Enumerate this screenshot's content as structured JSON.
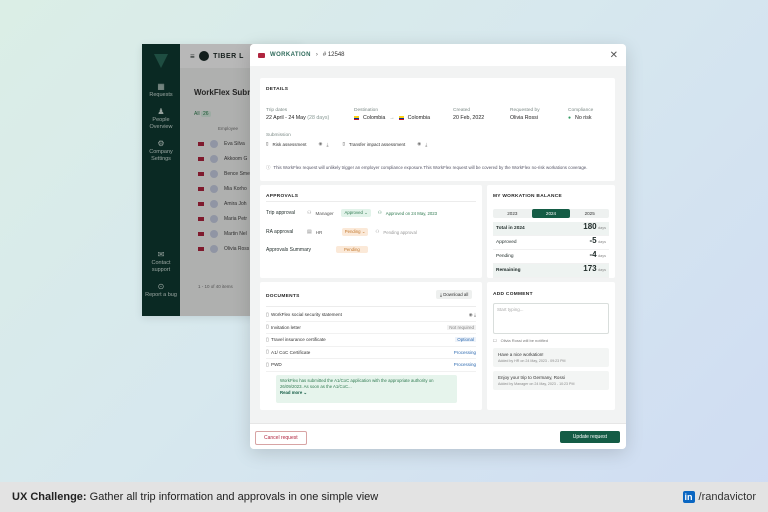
{
  "caption": {
    "challenge_label": "UX Challenge:",
    "challenge_text": "Gather all trip information and approvals in one simple view",
    "linkedin": "in",
    "handle": "/randavictor"
  },
  "app": {
    "brand": "TIBER L",
    "heading": "WorkFlex Submis",
    "filter": "All",
    "filter_count": "26",
    "employee_label": "Employee",
    "sidebar": [
      {
        "icon": "grid-icon",
        "label": "Requests"
      },
      {
        "icon": "user-icon",
        "label": "People Overview"
      },
      {
        "icon": "gear-icon",
        "label": "Company Settings"
      },
      {
        "icon": "mail-icon",
        "label": "Contact support"
      },
      {
        "icon": "bug-icon",
        "label": "Report a bug"
      }
    ],
    "rows": [
      "Eva Silva",
      "Akkoom G",
      "Bence Sme",
      "Mia Korho",
      "Amira Joh",
      "Maria Petr",
      "Martin Nel",
      "Olivia Ross"
    ],
    "pagination": "1 - 10 of 40 items"
  },
  "modal": {
    "breadcrumb": "WORKATION",
    "id": "# 12548",
    "details": {
      "title": "DETAILS",
      "trip_dates_label": "Trip dates",
      "trip_dates": "22 April - 24 May",
      "trip_days": "(28 days)",
      "destination_label": "Destination",
      "from": "Colombia",
      "to": "Colombia",
      "created_label": "Created",
      "created": "20 Feb, 2022",
      "requested_by_label": "Requested by",
      "requested_by": "Olivia Rossi",
      "compliance_label": "Compliance",
      "compliance": "No risk",
      "submission_label": "Submission",
      "doc1": "Risk assessment",
      "doc2": "Transfer impact assessment",
      "info": "This WorkFlex request will unlikely trigger an employer compliance exposure.This WorkFlex request will be covered by the WorkFlex no-risk workations coverage."
    },
    "approvals": {
      "title": "APPROVALS",
      "trip_label": "Trip approval",
      "trip_who": "Manager",
      "trip_status": "Approved",
      "trip_note": "Approved on 24 May, 2023",
      "ra_label": "RA approval",
      "ra_who": "HR",
      "ra_status": "Pending",
      "ra_note": "Pending approval",
      "summary_label": "Approvals Summary",
      "summary_status": "Pending"
    },
    "balance": {
      "title": "MY WORKATION BALANCE",
      "tabs": [
        "2023",
        "2024",
        "2025"
      ],
      "active_tab": "2024",
      "unit": "days",
      "rows": [
        {
          "label": "Total in 2024",
          "value": "180"
        },
        {
          "label": "Approved",
          "value": "-5"
        },
        {
          "label": "Pending",
          "value": "-4"
        },
        {
          "label": "Remaining",
          "value": "173"
        }
      ]
    },
    "documents": {
      "title": "DOCUMENTS",
      "download_all": "Download all",
      "items": [
        {
          "name": "WorkFlex social security statement",
          "status": ""
        },
        {
          "name": "Invitation letter",
          "status": "Not required"
        },
        {
          "name": "Travel insurance certificate",
          "status": "Optional"
        },
        {
          "name": "A1/ CoC Certificate",
          "status": "Processing"
        },
        {
          "name": "PWD",
          "status": "Processing"
        }
      ],
      "notice": "WorkFlex has submitted the A1/CoC application with the appropriate authority on 26/09/2023. As soon as the A1/CoC...",
      "read_more": "Read more"
    },
    "comments": {
      "title": "ADD COMMENT",
      "placeholder": "Start typing...",
      "notify": "Olivia Rossi will be notified",
      "items": [
        {
          "text": "Have a nice workation!",
          "meta": "Added by HR on 24 May, 2023 - 09:23 PM"
        },
        {
          "text": "Enjoy your trip to Germany, Rossi",
          "meta": "Added by Manager on 24 May, 2023 - 10:23 PM"
        }
      ]
    },
    "cancel": "Cancel request",
    "update": "Update request"
  }
}
